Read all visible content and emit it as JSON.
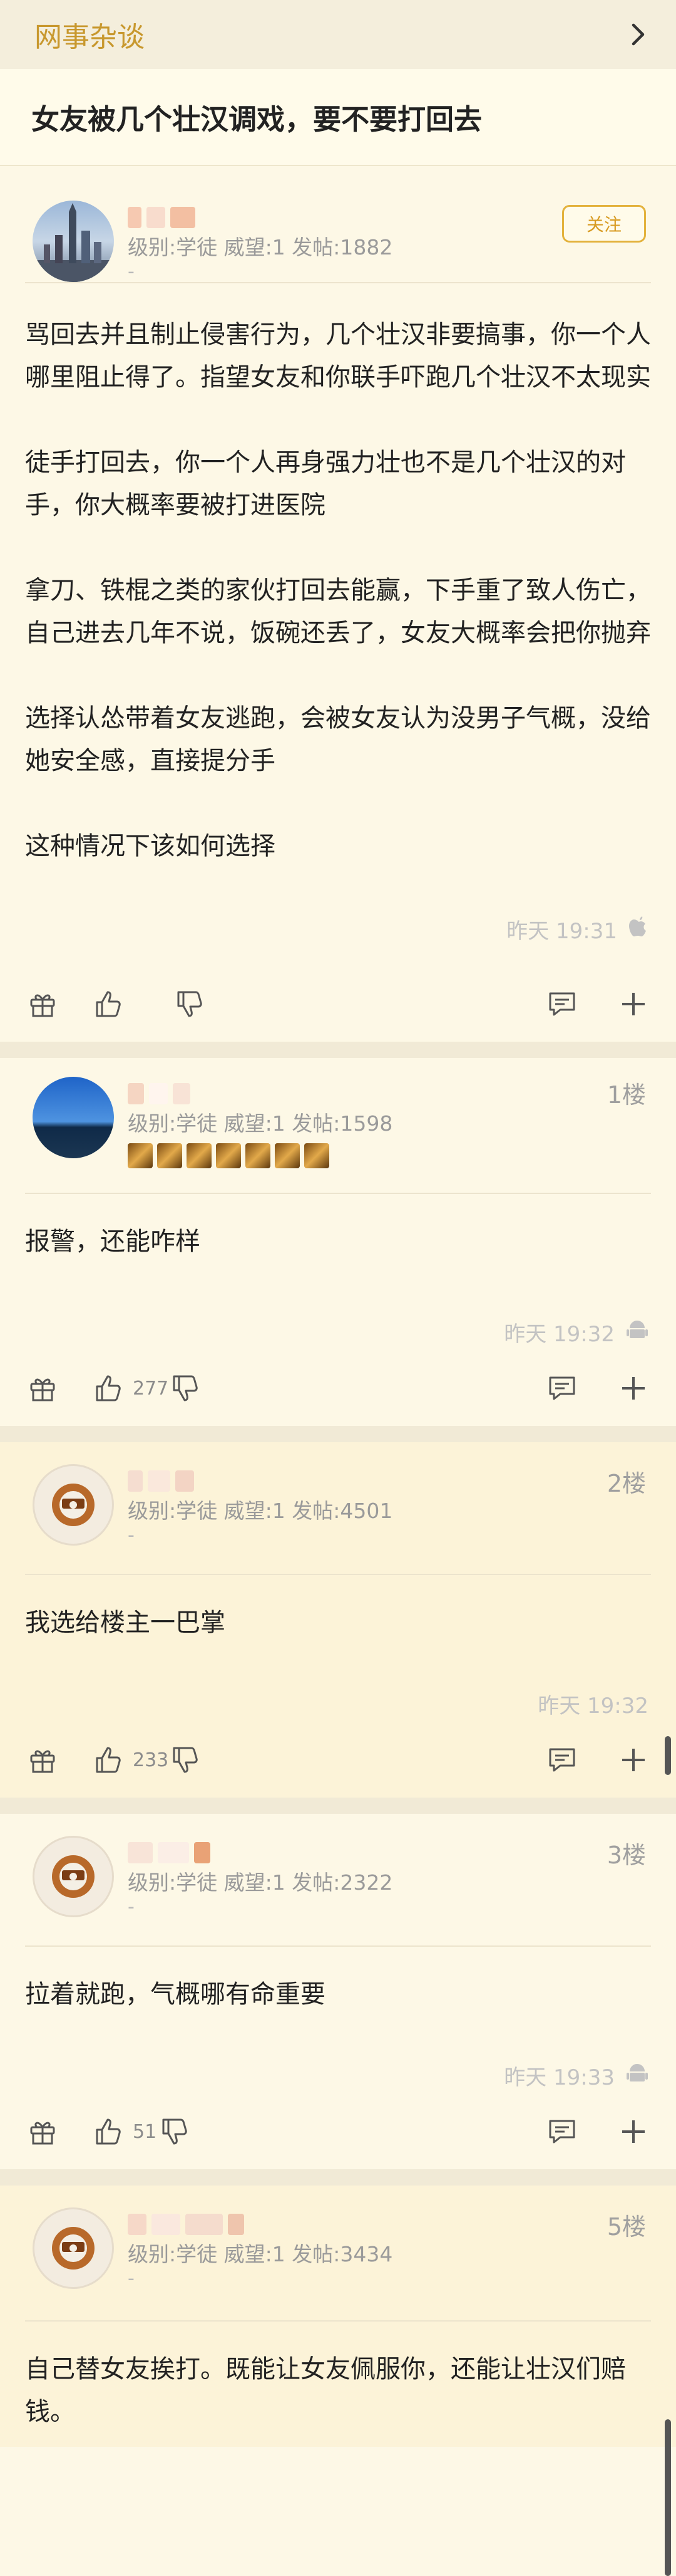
{
  "header": {
    "forum_name": "网事杂谈",
    "back_icon": "chevron-right-icon"
  },
  "thread": {
    "title": "女友被几个壮汉调戏，要不要打回去"
  },
  "op": {
    "meta": "级别:学徒 威望:1 发帖:1882",
    "dash": "-",
    "follow_label": "关注",
    "paragraphs": [
      "骂回去并且制止侵害行为，几个壮汉非要搞事，你一个人哪里阻止得了。指望女友和你联手吓跑几个壮汉不太现实",
      "徒手打回去，你一个人再身强力壮也不是几个壮汉的对手，你大概率要被打进医院",
      "拿刀、铁棍之类的家伙打回去能赢，下手重了致人伤亡，自己进去几年不说，饭碗还丢了，女友大概率会把你抛弃",
      "选择认怂带着女友逃跑，会被女友认为没男子气概，没给她安全感，直接提分手",
      "这种情况下该如何选择"
    ],
    "time": "昨天 19:31",
    "device_icon": "apple-icon",
    "like_count": ""
  },
  "replies": [
    {
      "floor": "1楼",
      "meta": "级别:学徒 威望:1 发帖:1598",
      "text": "报警，还能咋样",
      "time": "昨天 19:32",
      "device_icon": "android-icon",
      "like_count": "277"
    },
    {
      "floor": "2楼",
      "meta": "级别:学徒 威望:1 发帖:4501",
      "dash": "-",
      "text": "我选给楼主一巴掌",
      "time": "昨天 19:32",
      "like_count": "233"
    },
    {
      "floor": "3楼",
      "meta": "级别:学徒 威望:1 发帖:2322",
      "dash": "-",
      "text": "拉着就跑，气概哪有命重要",
      "time": "昨天 19:33",
      "device_icon": "android-icon",
      "like_count": "51"
    },
    {
      "floor": "5楼",
      "meta": "级别:学徒 威望:1 发帖:3434",
      "dash": "-",
      "text": "自己替女友挨打。既能让女友佩服你，还能让壮汉们赔钱。"
    }
  ],
  "colors": {
    "accent": "#c8982e",
    "follow": "#e3b23c",
    "background": "#fdf8e6"
  }
}
